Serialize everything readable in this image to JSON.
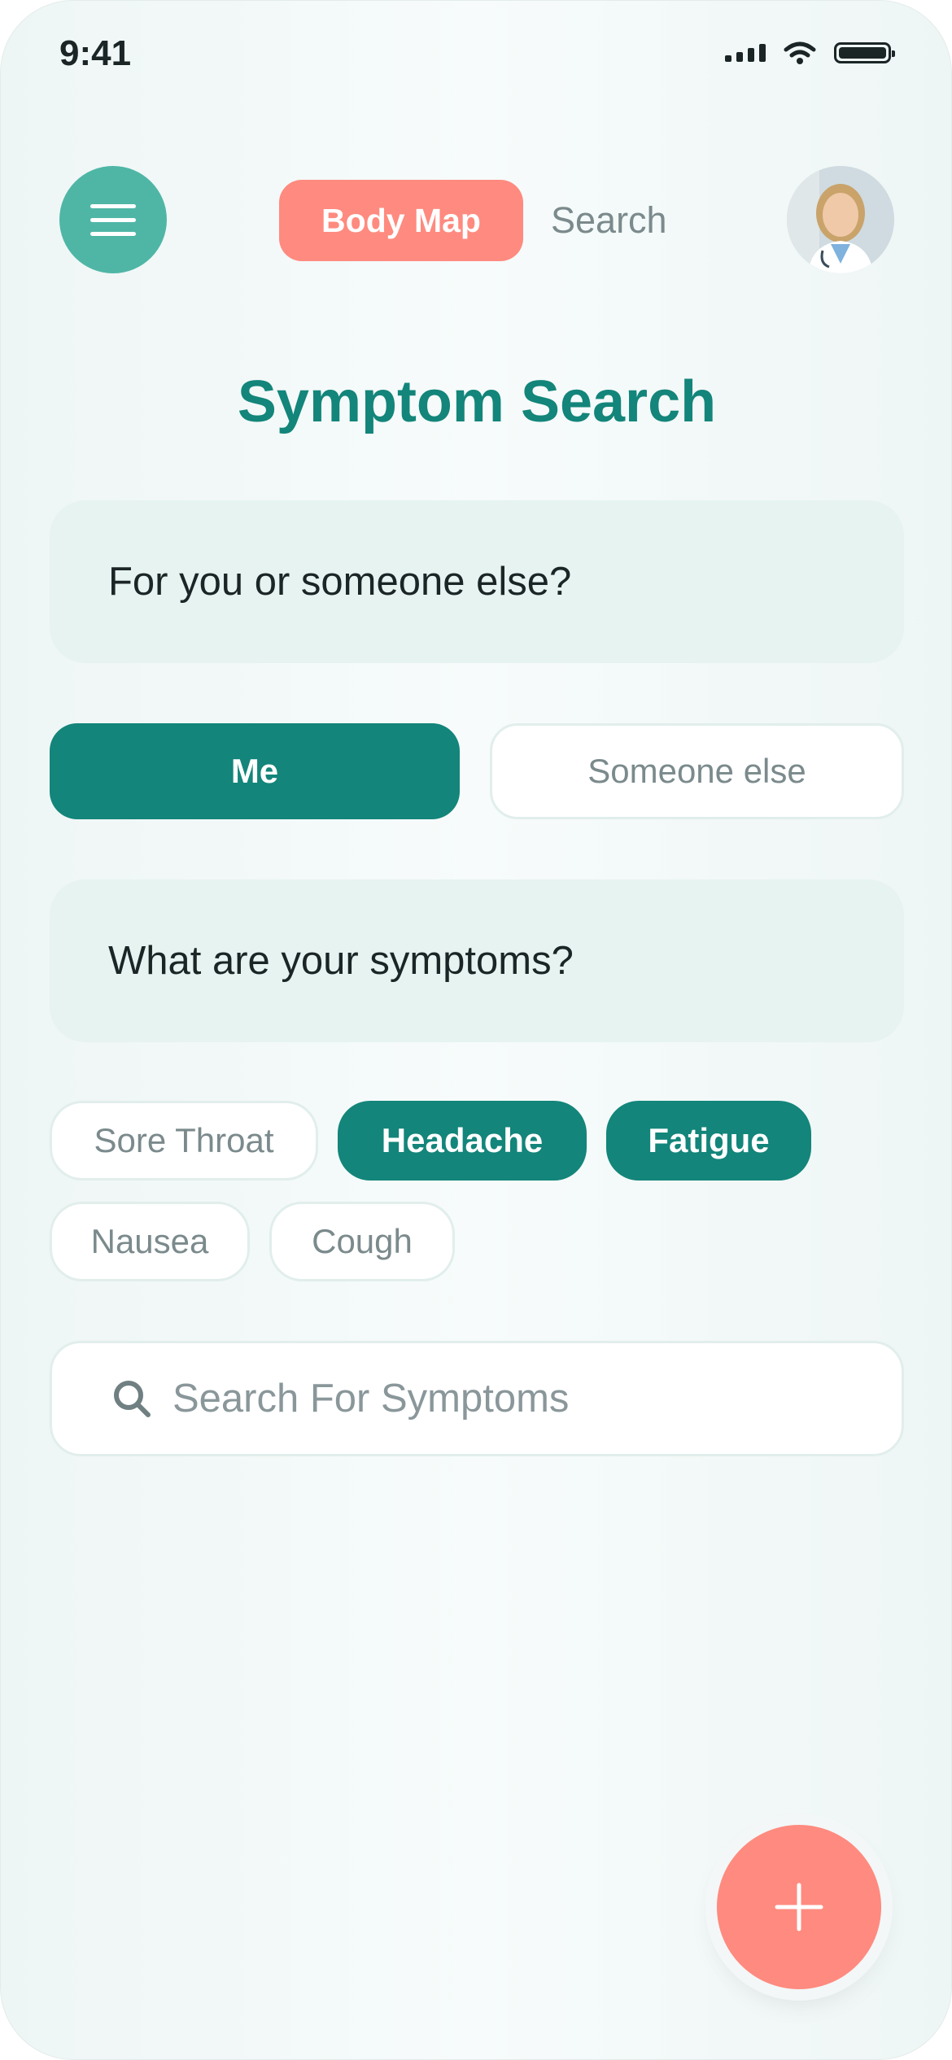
{
  "status_bar": {
    "time": "9:41"
  },
  "header": {
    "tabs": [
      {
        "label": "Body Map",
        "active": true
      },
      {
        "label": "Search",
        "active": false
      }
    ],
    "avatar_icon": "doctor-avatar"
  },
  "page_title": "Symptom Search",
  "question_1": "For you or someone else?",
  "choices": [
    {
      "label": "Me",
      "selected": true
    },
    {
      "label": "Someone else",
      "selected": false
    }
  ],
  "question_2": "What are your symptoms?",
  "symptom_chips": [
    {
      "label": "Sore Throat",
      "selected": false
    },
    {
      "label": "Headache",
      "selected": true
    },
    {
      "label": "Fatigue",
      "selected": true
    },
    {
      "label": "Nausea",
      "selected": false
    },
    {
      "label": "Cough",
      "selected": false
    }
  ],
  "search": {
    "placeholder": "Search For Symptoms",
    "value": ""
  },
  "fab_icon": "plus-icon",
  "colors": {
    "primary": "#13857a",
    "accent": "#ff8a7f",
    "menu": "#4fb6a6",
    "card": "#e6f3f1"
  }
}
